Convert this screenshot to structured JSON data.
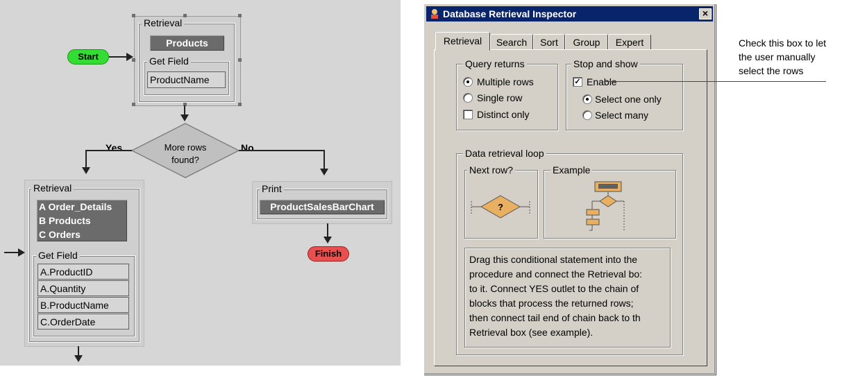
{
  "flow": {
    "start_label": "Start",
    "retrieval1": {
      "title": "Retrieval",
      "table": "Products",
      "getfield_title": "Get Field",
      "field": "ProductName"
    },
    "decision": {
      "text_line1": "More rows",
      "text_line2": "found?",
      "yes": "Yes",
      "no": "No"
    },
    "retrieval2": {
      "title": "Retrieval",
      "tables": [
        "A Order_Details",
        "B Products",
        "C Orders"
      ],
      "getfield_title": "Get Field",
      "fields": [
        "A.ProductID",
        "A.Quantity",
        "B.ProductName",
        "C.OrderDate"
      ]
    },
    "print": {
      "title": "Print",
      "value": "ProductSalesBarChart"
    },
    "finish_label": "Finish"
  },
  "dialog": {
    "title": "Database Retrieval Inspector",
    "close_glyph": "×",
    "tabs": [
      "Retrieval",
      "Search",
      "Sort",
      "Group",
      "Expert"
    ],
    "query_returns": {
      "title": "Query returns",
      "options": [
        "Multiple rows",
        "Single row"
      ],
      "selected": "Multiple rows",
      "distinct_label": "Distinct only",
      "distinct_checked": false
    },
    "stop_and_show": {
      "title": "Stop and show",
      "enable_label": "Enable",
      "enable_checked": true,
      "options": [
        "Select one only",
        "Select many"
      ],
      "selected": "Select one only"
    },
    "loop": {
      "title": "Data retrieval loop",
      "next_row_title": "Next row?",
      "example_title": "Example",
      "description": "Drag this conditional statement into the procedure and connect the Retrieval bo: to it. Connect YES outlet to the chain of blocks that process the returned rows; then connect tail end of chain back to th Retrieval box (see example).",
      "description_lines": [
        "Drag this conditional statement into the",
        "procedure and connect the Retrieval bo:",
        "to it. Connect YES outlet to the chain of",
        "blocks that process the returned rows;",
        "then connect tail end of chain back to th",
        "Retrieval box (see example)."
      ]
    }
  },
  "callout": {
    "lines": [
      "Check this box to let",
      "the user manually",
      "select the rows"
    ]
  },
  "colors": {
    "start": "#33dd33",
    "finish": "#e85050",
    "titlebar": "#08246b",
    "canvas": "#d6d6d6"
  }
}
